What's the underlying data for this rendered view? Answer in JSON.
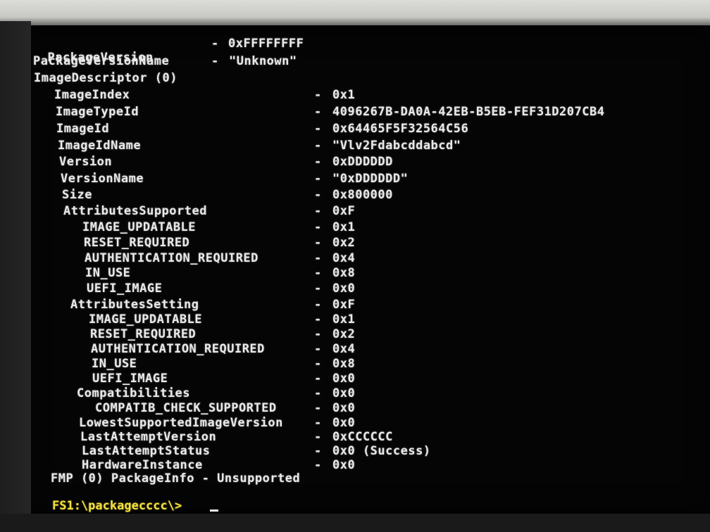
{
  "header": {
    "package_version_key": "PackageVersion",
    "package_version_value": "0xFFFFFFFF",
    "package_version_name_key": "PackageVersionName",
    "package_version_name_value": "\"Unknown\"",
    "image_descriptor": "ImageDescriptor (0)"
  },
  "fields": [
    {
      "key": "ImageIndex",
      "value": "0x1"
    },
    {
      "key": "ImageTypeId",
      "value": "4096267B-DA0A-42EB-B5EB-FEF31D207CB4"
    },
    {
      "key": "ImageId",
      "value": "0x64465F5F32564C56"
    },
    {
      "key": "ImageIdName",
      "value": "\"Vlv2Fdabcddabcd\""
    },
    {
      "key": "Version",
      "value": "0xDDDDDD"
    },
    {
      "key": "VersionName",
      "value": "\"0xDDDDDD\""
    },
    {
      "key": "Size",
      "value": "0x800000"
    },
    {
      "key": "AttributesSupported",
      "value": "0xF"
    },
    {
      "key": "IMAGE_UPDATABLE",
      "value": "0x1"
    },
    {
      "key": "RESET_REQUIRED",
      "value": "0x2"
    },
    {
      "key": "AUTHENTICATION_REQUIRED",
      "value": "0x4"
    },
    {
      "key": "IN_USE",
      "value": "0x8"
    },
    {
      "key": "UEFI_IMAGE",
      "value": "0x0"
    },
    {
      "key": "AttributesSetting",
      "value": "0xF"
    },
    {
      "key": "IMAGE_UPDATABLE",
      "value": "0x1"
    },
    {
      "key": "RESET_REQUIRED",
      "value": "0x2"
    },
    {
      "key": "AUTHENTICATION_REQUIRED",
      "value": "0x4"
    },
    {
      "key": "IN_USE",
      "value": "0x8"
    },
    {
      "key": "UEFI_IMAGE",
      "value": "0x0"
    },
    {
      "key": "Compatibilities",
      "value": "0x0"
    },
    {
      "key": "COMPATIB_CHECK_SUPPORTED",
      "value": "0x0"
    },
    {
      "key": "LowestSupportedImageVersion",
      "value": "0x0"
    },
    {
      "key": "LastAttemptVersion",
      "value": "0xCCCCCC"
    },
    {
      "key": "LastAttemptStatus",
      "value": "0x0 (Success)"
    },
    {
      "key": "HardwareInstance",
      "value": "0x0"
    }
  ],
  "separator": "-",
  "footer": "FMP (0) PackageInfo - Unsupported",
  "prompt": "FS1:\\packagecccc\\>"
}
